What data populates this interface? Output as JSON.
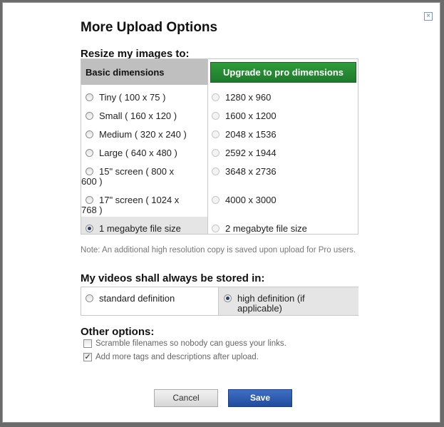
{
  "dialog": {
    "title": "More Upload Options",
    "close_symbol": "×"
  },
  "resize": {
    "heading": "Resize my images to:",
    "basic_header": "Basic dimensions",
    "upgrade_button": "Upgrade to pro dimensions",
    "basic_options": [
      {
        "label": "Tiny ( 100 x 75 )",
        "selected": false
      },
      {
        "label": "Small ( 160 x 120 )",
        "selected": false
      },
      {
        "label": "Medium ( 320 x 240 )",
        "selected": false
      },
      {
        "label": "Large ( 640 x 480 )",
        "selected": false
      },
      {
        "label": "15\" screen ( 800 x 600 )",
        "selected": false
      },
      {
        "label": "17\" screen ( 1024 x 768 )",
        "selected": false
      },
      {
        "label": "1 megabyte file size",
        "selected": true
      }
    ],
    "pro_options": [
      {
        "label": "1280 x 960"
      },
      {
        "label": "1600 x 1200"
      },
      {
        "label": "2048 x 1536"
      },
      {
        "label": "2592 x 1944"
      },
      {
        "label": "3648 x 2736"
      },
      {
        "label": "4000 x 3000"
      },
      {
        "label": "2 megabyte file size"
      }
    ],
    "note": "Note: An additional high resolution copy is saved upon upload for Pro users."
  },
  "video": {
    "heading": "My videos shall always be stored in:",
    "standard_label": "standard definition",
    "hd_label": "high definition (if applicable)",
    "selected": "hd"
  },
  "other": {
    "heading": "Other options:",
    "scramble_label": "Scramble filenames so nobody can guess your links.",
    "scramble_checked": false,
    "tags_label": "Add more tags and descriptions after upload.",
    "tags_checked": true
  },
  "buttons": {
    "cancel": "Cancel",
    "save": "Save"
  },
  "icons": {
    "close": "close-icon",
    "check": "✓"
  }
}
